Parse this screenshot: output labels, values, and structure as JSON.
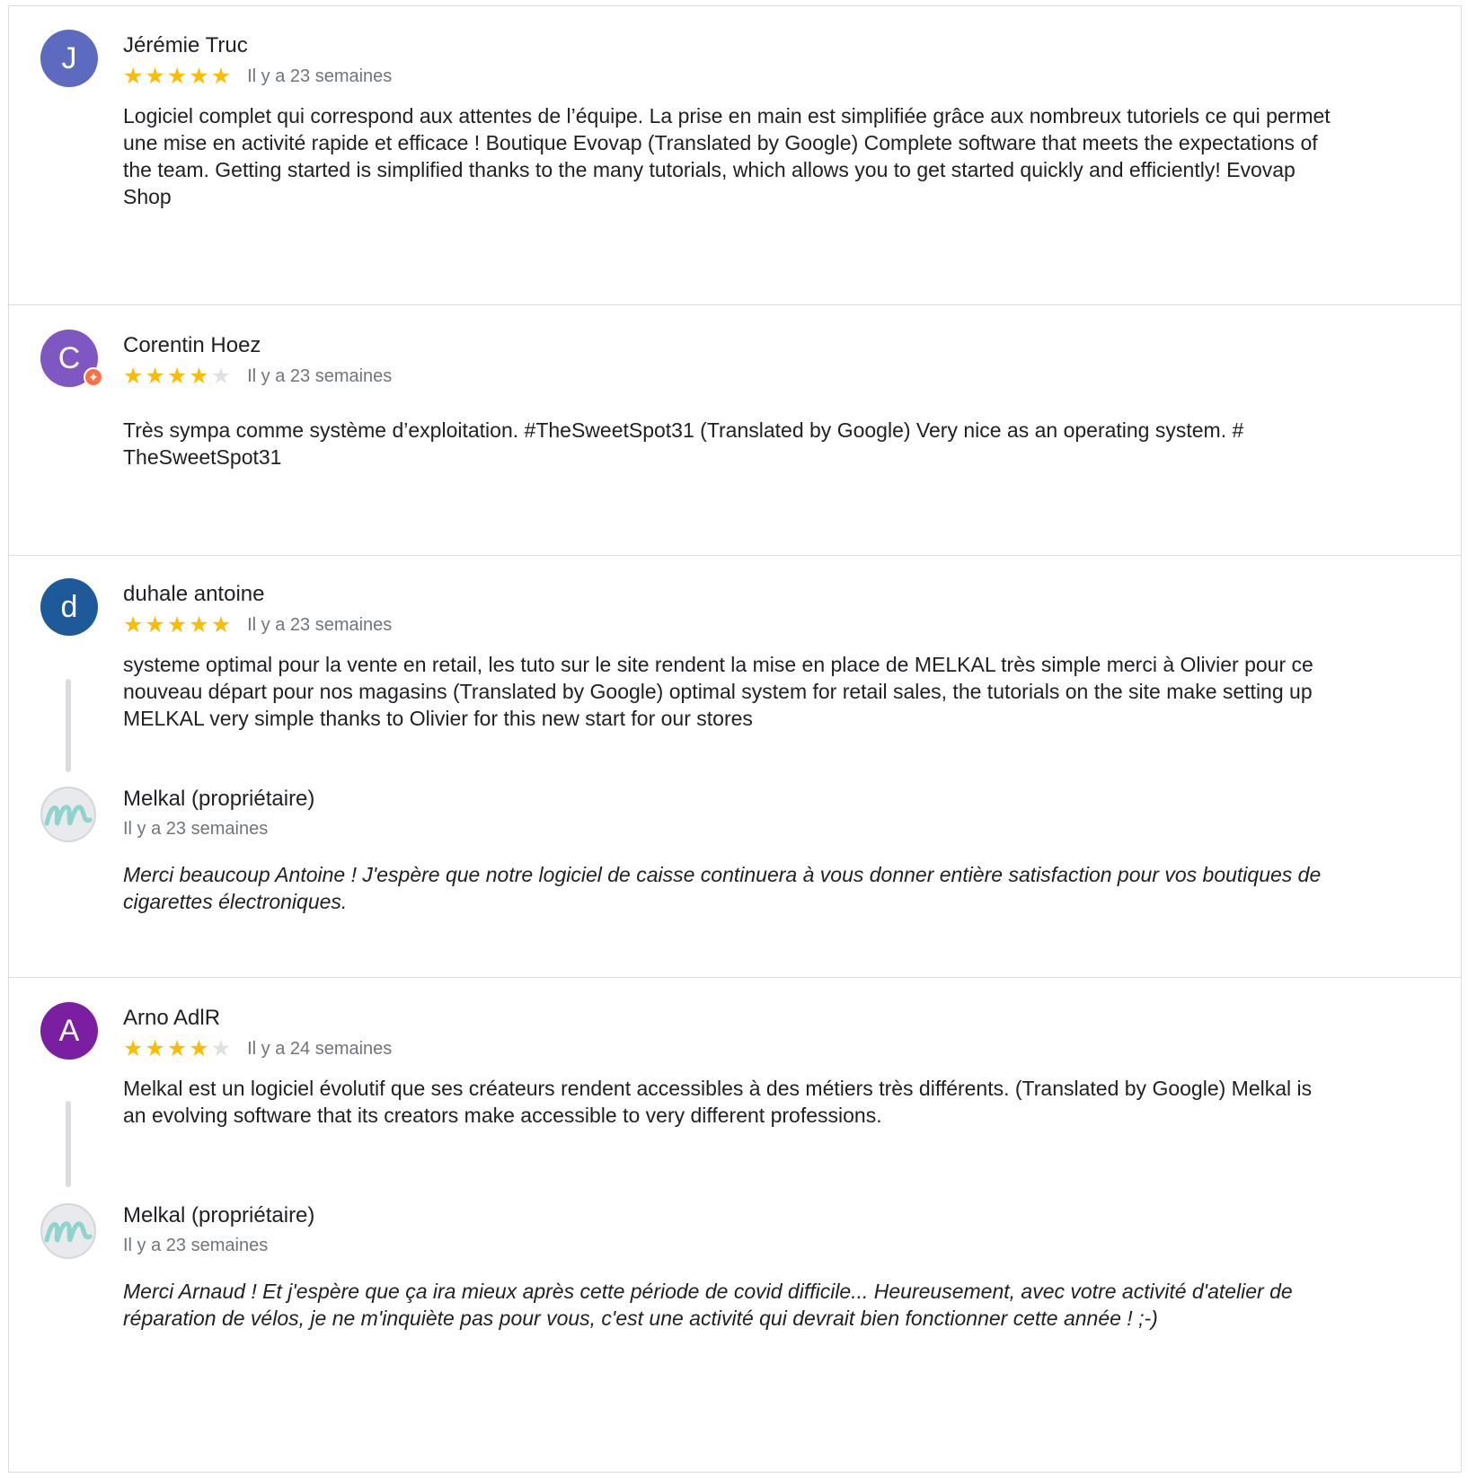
{
  "reviews": [
    {
      "author": "Jérémie Truc",
      "avatar_letter": "J",
      "avatar_color": "#5c6bc0",
      "rating": 5,
      "time": "Il y a 23 semaines",
      "text": "Logiciel complet qui correspond aux attentes de l’équipe. La prise en main est simplifiée grâce aux nombreux tutoriels ce qui permet une mise en activité rapide et efficace ! Boutique Evovap (Translated by Google) Complete software that meets the expectations of the team. Getting started is simplified thanks to the many tutorials, which allows you to get started quickly and efficiently! Evovap Shop"
    },
    {
      "author": "Corentin Hoez",
      "avatar_letter": "C",
      "avatar_color": "#7e57c2",
      "local_guide_badge": "✦",
      "rating": 4,
      "time": "Il y a 23 semaines",
      "text": "Très sympa comme système d’exploitation. #TheSweetSpot31 (Translated by Google) Very nice as an operating system. # TheSweetSpot31"
    },
    {
      "author": "duhale antoine",
      "avatar_letter": "d",
      "avatar_color": "#1e5a9a",
      "rating": 5,
      "time": "Il y a 23 semaines",
      "text": "systeme optimal pour la vente en retail, les tuto sur le site rendent la mise en place de MELKAL très simple merci à Olivier pour ce nouveau départ pour nos magasins (Translated by Google) optimal system for retail sales, the tutorials on the site make setting up MELKAL very simple thanks to Olivier for this new start for our stores",
      "owner_reply": {
        "name": "Melkal (propriétaire)",
        "time": "Il y a 23 semaines",
        "text": "Merci beaucoup Antoine ! J'espère que notre logiciel de caisse continuera à vous donner entière satisfaction pour vos boutiques de cigarettes électroniques."
      }
    },
    {
      "author": "Arno AdlR",
      "avatar_letter": "A",
      "avatar_color": "#7b1fa2",
      "rating": 4,
      "time": "Il y a 24 semaines",
      "text": "Melkal est un logiciel évolutif que ses créateurs rendent accessibles à des métiers très différents. (Translated by Google) Melkal is an evolving software that its creators make accessible to very different professions.",
      "owner_reply": {
        "name": "Melkal (propriétaire)",
        "time": "Il y a 23 semaines",
        "text": "Merci Arnaud ! Et j'espère que ça ira mieux après cette période de covid difficile... Heureusement, avec votre activité d'atelier de réparation de vélos, je ne m'inquiète pas pour vous, c'est une activité qui devrait bien fonctionner cette année ! ;-)"
      }
    }
  ],
  "icons": {
    "star_filled": "★",
    "star_empty": "★",
    "owner_logo": "m"
  },
  "colors": {
    "star": "#fbbc04",
    "star_empty": "#e0e0e0",
    "owner_logo": "#8fd3cf"
  }
}
